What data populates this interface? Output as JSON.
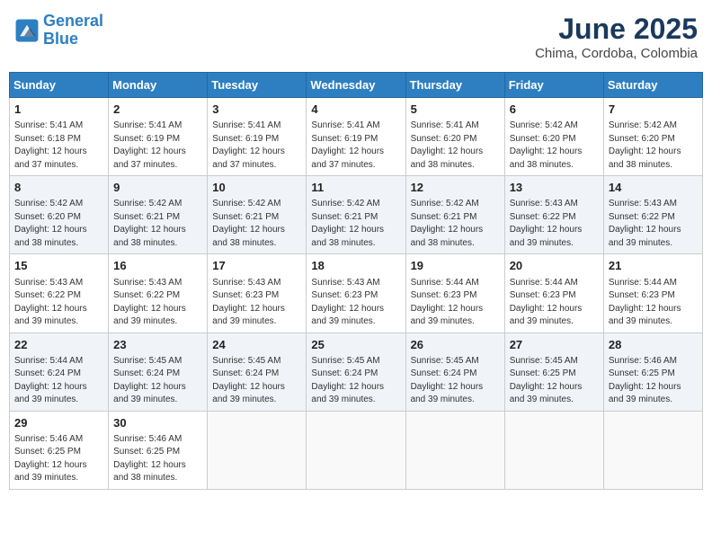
{
  "logo": {
    "line1": "General",
    "line2": "Blue"
  },
  "title": "June 2025",
  "subtitle": "Chima, Cordoba, Colombia",
  "days_of_week": [
    "Sunday",
    "Monday",
    "Tuesday",
    "Wednesday",
    "Thursday",
    "Friday",
    "Saturday"
  ],
  "weeks": [
    [
      {
        "day": "1",
        "sunrise": "5:41 AM",
        "sunset": "6:18 PM",
        "daylight": "12 hours and 37 minutes."
      },
      {
        "day": "2",
        "sunrise": "5:41 AM",
        "sunset": "6:19 PM",
        "daylight": "12 hours and 37 minutes."
      },
      {
        "day": "3",
        "sunrise": "5:41 AM",
        "sunset": "6:19 PM",
        "daylight": "12 hours and 37 minutes."
      },
      {
        "day": "4",
        "sunrise": "5:41 AM",
        "sunset": "6:19 PM",
        "daylight": "12 hours and 37 minutes."
      },
      {
        "day": "5",
        "sunrise": "5:41 AM",
        "sunset": "6:20 PM",
        "daylight": "12 hours and 38 minutes."
      },
      {
        "day": "6",
        "sunrise": "5:42 AM",
        "sunset": "6:20 PM",
        "daylight": "12 hours and 38 minutes."
      },
      {
        "day": "7",
        "sunrise": "5:42 AM",
        "sunset": "6:20 PM",
        "daylight": "12 hours and 38 minutes."
      }
    ],
    [
      {
        "day": "8",
        "sunrise": "5:42 AM",
        "sunset": "6:20 PM",
        "daylight": "12 hours and 38 minutes."
      },
      {
        "day": "9",
        "sunrise": "5:42 AM",
        "sunset": "6:21 PM",
        "daylight": "12 hours and 38 minutes."
      },
      {
        "day": "10",
        "sunrise": "5:42 AM",
        "sunset": "6:21 PM",
        "daylight": "12 hours and 38 minutes."
      },
      {
        "day": "11",
        "sunrise": "5:42 AM",
        "sunset": "6:21 PM",
        "daylight": "12 hours and 38 minutes."
      },
      {
        "day": "12",
        "sunrise": "5:42 AM",
        "sunset": "6:21 PM",
        "daylight": "12 hours and 38 minutes."
      },
      {
        "day": "13",
        "sunrise": "5:43 AM",
        "sunset": "6:22 PM",
        "daylight": "12 hours and 39 minutes."
      },
      {
        "day": "14",
        "sunrise": "5:43 AM",
        "sunset": "6:22 PM",
        "daylight": "12 hours and 39 minutes."
      }
    ],
    [
      {
        "day": "15",
        "sunrise": "5:43 AM",
        "sunset": "6:22 PM",
        "daylight": "12 hours and 39 minutes."
      },
      {
        "day": "16",
        "sunrise": "5:43 AM",
        "sunset": "6:22 PM",
        "daylight": "12 hours and 39 minutes."
      },
      {
        "day": "17",
        "sunrise": "5:43 AM",
        "sunset": "6:23 PM",
        "daylight": "12 hours and 39 minutes."
      },
      {
        "day": "18",
        "sunrise": "5:43 AM",
        "sunset": "6:23 PM",
        "daylight": "12 hours and 39 minutes."
      },
      {
        "day": "19",
        "sunrise": "5:44 AM",
        "sunset": "6:23 PM",
        "daylight": "12 hours and 39 minutes."
      },
      {
        "day": "20",
        "sunrise": "5:44 AM",
        "sunset": "6:23 PM",
        "daylight": "12 hours and 39 minutes."
      },
      {
        "day": "21",
        "sunrise": "5:44 AM",
        "sunset": "6:23 PM",
        "daylight": "12 hours and 39 minutes."
      }
    ],
    [
      {
        "day": "22",
        "sunrise": "5:44 AM",
        "sunset": "6:24 PM",
        "daylight": "12 hours and 39 minutes."
      },
      {
        "day": "23",
        "sunrise": "5:45 AM",
        "sunset": "6:24 PM",
        "daylight": "12 hours and 39 minutes."
      },
      {
        "day": "24",
        "sunrise": "5:45 AM",
        "sunset": "6:24 PM",
        "daylight": "12 hours and 39 minutes."
      },
      {
        "day": "25",
        "sunrise": "5:45 AM",
        "sunset": "6:24 PM",
        "daylight": "12 hours and 39 minutes."
      },
      {
        "day": "26",
        "sunrise": "5:45 AM",
        "sunset": "6:24 PM",
        "daylight": "12 hours and 39 minutes."
      },
      {
        "day": "27",
        "sunrise": "5:45 AM",
        "sunset": "6:25 PM",
        "daylight": "12 hours and 39 minutes."
      },
      {
        "day": "28",
        "sunrise": "5:46 AM",
        "sunset": "6:25 PM",
        "daylight": "12 hours and 39 minutes."
      }
    ],
    [
      {
        "day": "29",
        "sunrise": "5:46 AM",
        "sunset": "6:25 PM",
        "daylight": "12 hours and 39 minutes."
      },
      {
        "day": "30",
        "sunrise": "5:46 AM",
        "sunset": "6:25 PM",
        "daylight": "12 hours and 38 minutes."
      },
      null,
      null,
      null,
      null,
      null
    ]
  ],
  "labels": {
    "sunrise": "Sunrise:",
    "sunset": "Sunset:",
    "daylight": "Daylight:"
  }
}
